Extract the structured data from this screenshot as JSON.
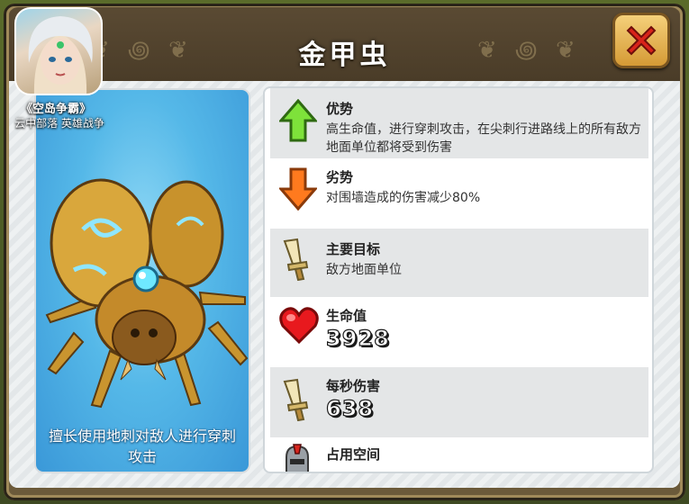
{
  "game_badge": {
    "title": "《空岛争霸》",
    "subtitle": "云中部落 英雄战争"
  },
  "header": {
    "title": "金甲虫",
    "close_icon": "close-x-icon"
  },
  "unit": {
    "description": "擅长使用地刺对敌人进行穿刺攻击"
  },
  "stats": {
    "advantage": {
      "label": "优势",
      "text": "高生命值，进行穿刺攻击，在尖刺行进路线上的所有敌方地面单位都将受到伤害",
      "icon": "green-up-arrow-icon"
    },
    "disadvantage": {
      "label": "劣势",
      "text": "对围墙造成的伤害减少80%",
      "icon": "orange-down-arrow-icon"
    },
    "target": {
      "label": "主要目标",
      "text": "敌方地面单位",
      "icon": "sword-icon"
    },
    "health": {
      "label": "生命值",
      "value": "3928",
      "icon": "heart-icon"
    },
    "dps": {
      "label": "每秒伤害",
      "value": "638",
      "icon": "sword-icon"
    },
    "space": {
      "label": "占用空间",
      "icon": "helmet-icon"
    }
  },
  "colors": {
    "accent": "#55b8e8",
    "frame": "#6b5a3a",
    "close_button": "#d59a35"
  }
}
